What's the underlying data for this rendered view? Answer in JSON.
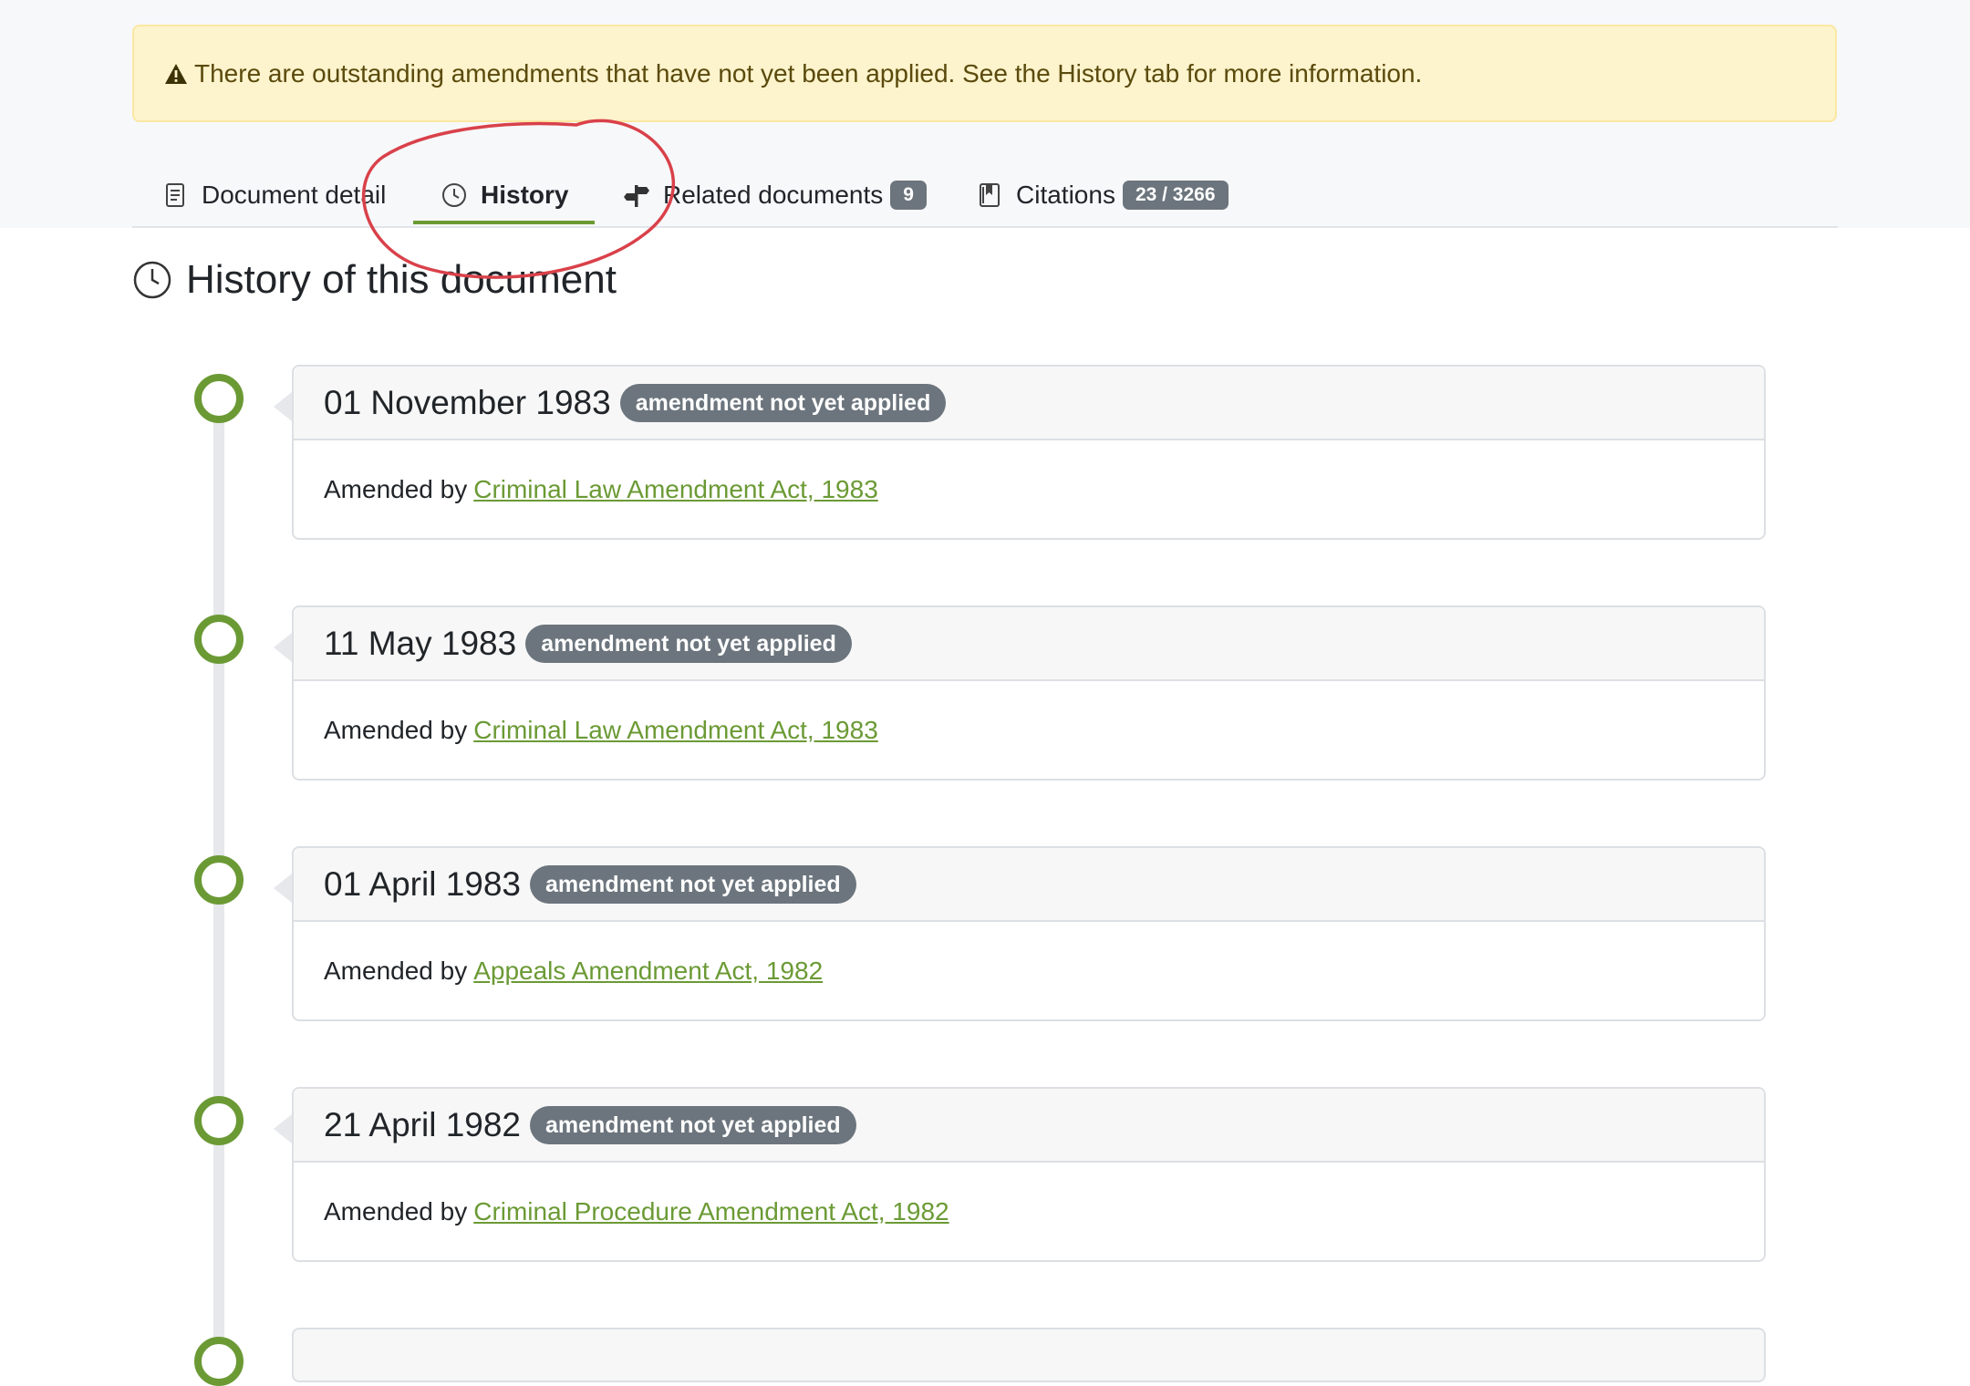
{
  "alert": {
    "icon": "warning-triangle-icon",
    "text": "There are outstanding amendments that have not yet been applied. See the History tab for more information."
  },
  "tabs": [
    {
      "label": "Document detail",
      "icon": "document-icon",
      "active": false
    },
    {
      "label": "History",
      "icon": "clock-icon",
      "active": true
    },
    {
      "label": "Related documents",
      "icon": "signpost-icon",
      "count": "9",
      "active": false
    },
    {
      "label": "Citations",
      "icon": "bookmark-book-icon",
      "count": "23 / 3266",
      "active": false
    }
  ],
  "section": {
    "title": "History of this document",
    "icon": "clock-icon"
  },
  "timeline": [
    {
      "date": "01 November 1983",
      "badge": "amendment not yet applied",
      "prefix": "Amended by",
      "link": "Criminal Law Amendment Act, 1983"
    },
    {
      "date": "11 May 1983",
      "badge": "amendment not yet applied",
      "prefix": "Amended by",
      "link": "Criminal Law Amendment Act, 1983"
    },
    {
      "date": "01 April 1983",
      "badge": "amendment not yet applied",
      "prefix": "Amended by",
      "link": "Appeals Amendment Act, 1982"
    },
    {
      "date": "21 April 1982",
      "badge": "amendment not yet applied",
      "prefix": "Amended by",
      "link": "Criminal Procedure Amendment Act, 1982"
    }
  ],
  "colors": {
    "accent": "#6b9a35",
    "alert_bg": "#fdf3cc",
    "badge_bg": "#6c757d",
    "annotation": "#d9414a"
  }
}
